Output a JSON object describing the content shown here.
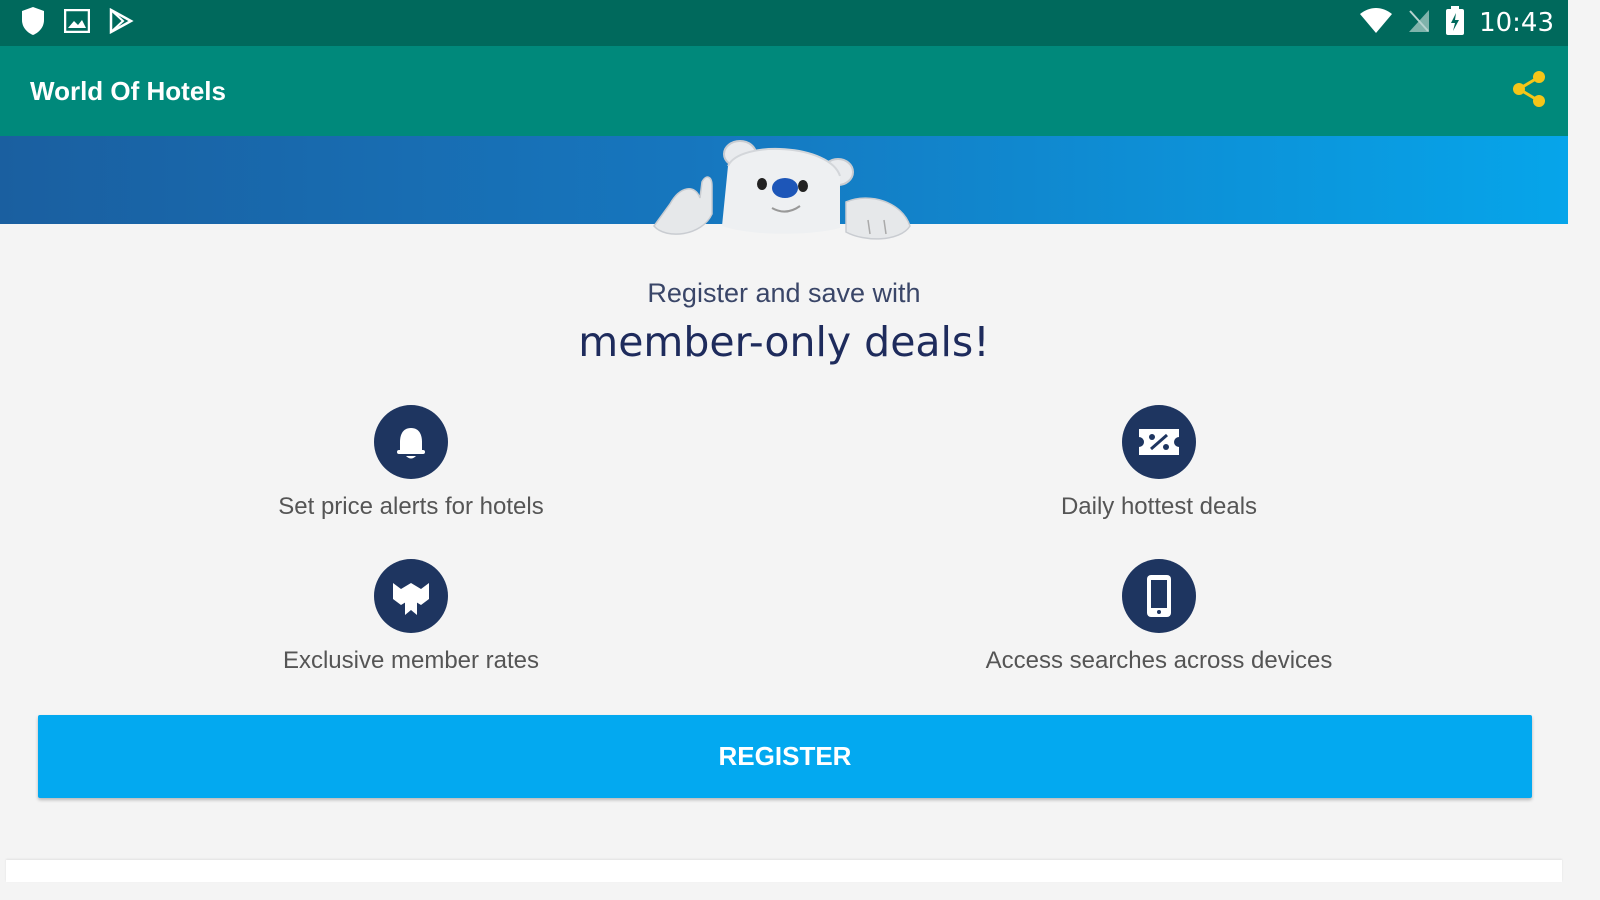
{
  "status_bar": {
    "left_icons": [
      "shield-icon",
      "image-icon",
      "play-store-icon"
    ],
    "right_icons": [
      "wifi-icon",
      "no-signal-icon",
      "battery-icon"
    ],
    "time": "10:43"
  },
  "app_bar": {
    "title": "World Of Hotels",
    "share_icon": "share-icon",
    "share_color": "#f5c518"
  },
  "promo": {
    "line1": "Register and save with",
    "line2": "member-only deals!"
  },
  "features": [
    {
      "icon": "bell-icon",
      "label": "Set price alerts for hotels"
    },
    {
      "icon": "discount-ticket-icon",
      "label": "Daily hottest deals"
    },
    {
      "icon": "member-badge-icon",
      "label": "Exclusive member rates"
    },
    {
      "icon": "phone-icon",
      "label": "Access searches across devices"
    }
  ],
  "register_button": {
    "label": "REGISTER"
  },
  "colors": {
    "status_bar": "#00695c",
    "app_bar": "#00897b",
    "icon_circle": "#1e3560",
    "button": "#03a9f0"
  }
}
